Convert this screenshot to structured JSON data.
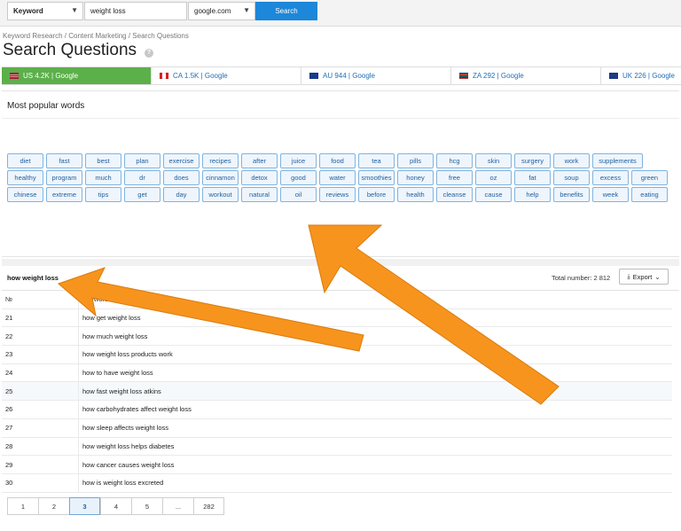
{
  "search": {
    "type_select": "Keyword",
    "query_value": "weight loss",
    "database_select": "google.com",
    "search_label": "Search"
  },
  "breadcrumb": "Keyword Research / Content Marketing / Search Questions",
  "page_title": "Search Questions",
  "info_icon_label": "?",
  "tabs": [
    {
      "label": "US 4.2K | Google",
      "flag": "us",
      "active": true
    },
    {
      "label": "CA 1.5K | Google",
      "flag": "ca",
      "active": false
    },
    {
      "label": "AU 944 | Google",
      "flag": "au",
      "active": false
    },
    {
      "label": "ZA 292 | Google",
      "flag": "za",
      "active": false
    },
    {
      "label": "UK 226 | Google",
      "flag": "uk",
      "active": false
    }
  ],
  "popular_words": {
    "title": "Most popular words",
    "words": [
      "diet",
      "fast",
      "best",
      "plan",
      "exercise",
      "recipes",
      "after",
      "juice",
      "food",
      "tea",
      "pills",
      "hcg",
      "skin",
      "surgery",
      "work",
      "supplements",
      "healthy",
      "program",
      "much",
      "dr",
      "does",
      "cinnamon",
      "detox",
      "good",
      "water",
      "smoothies",
      "honey",
      "free",
      "oz",
      "fat",
      "soup",
      "excess",
      "green",
      "chinese",
      "extreme",
      "tips",
      "get",
      "day",
      "workout",
      "natural",
      "oil",
      "reviews",
      "before",
      "health",
      "cleanse",
      "cause",
      "help",
      "benefits",
      "week",
      "eating"
    ]
  },
  "results": {
    "query": "how weight loss",
    "total_label": "Total number:",
    "total_value": "2 812",
    "export_label": "Export",
    "columns": [
      "№",
      "Keywords"
    ],
    "rows": [
      {
        "n": "21",
        "kw": "how get weight loss"
      },
      {
        "n": "22",
        "kw": "how much weight loss"
      },
      {
        "n": "23",
        "kw": "how weight loss products work"
      },
      {
        "n": "24",
        "kw": "how to have weight loss"
      },
      {
        "n": "25",
        "kw": "how fast weight loss atkins"
      },
      {
        "n": "26",
        "kw": "how carbohydrates affect weight loss"
      },
      {
        "n": "27",
        "kw": "how sleep affects weight loss"
      },
      {
        "n": "28",
        "kw": "how weight loss helps diabetes"
      },
      {
        "n": "29",
        "kw": "how cancer causes weight loss"
      },
      {
        "n": "30",
        "kw": "how is weight loss excreted"
      }
    ]
  },
  "pagination": {
    "pages": [
      "1",
      "2",
      "3",
      "4",
      "5",
      "...",
      "282"
    ],
    "current": "3"
  },
  "colors": {
    "active_tab": "#5cb04a",
    "search_button": "#1d87d9",
    "chip_border": "#7fb4e0",
    "arrow": "#f7941d"
  }
}
